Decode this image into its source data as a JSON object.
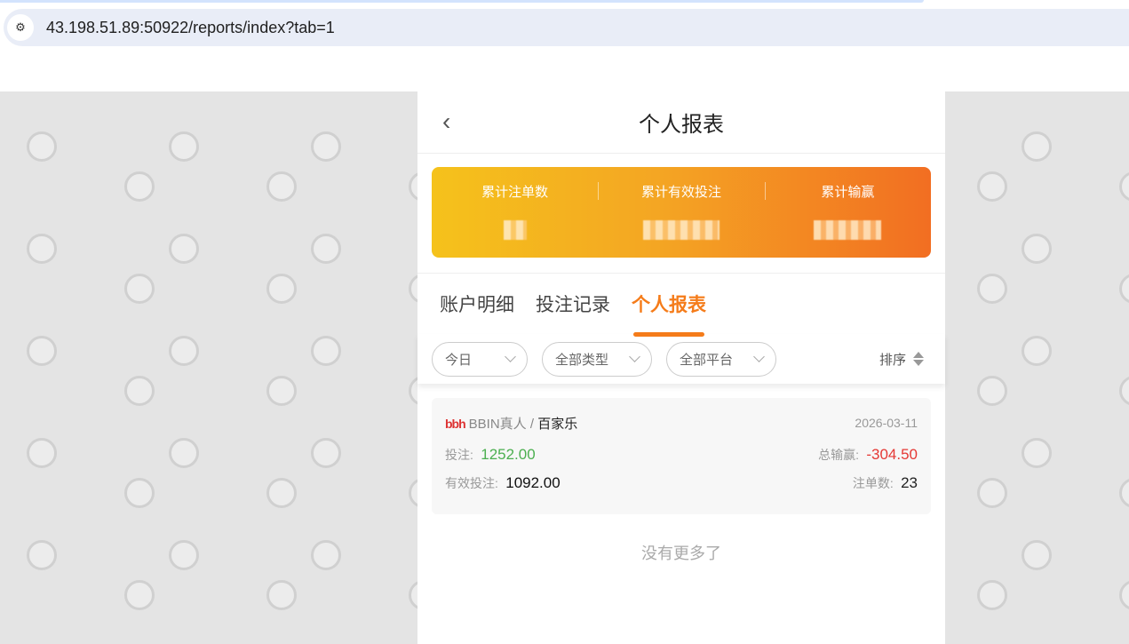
{
  "browser": {
    "url": "43.198.51.89:50922/reports/index?tab=1",
    "site_icon": "tune-icon"
  },
  "header": {
    "title": "个人报表"
  },
  "summary": [
    {
      "label": "累计注单数"
    },
    {
      "label": "累计有效投注"
    },
    {
      "label": "累计输赢"
    }
  ],
  "tabs": [
    {
      "label": "账户明细"
    },
    {
      "label": "投注记录"
    },
    {
      "label": "个人报表",
      "active": true
    }
  ],
  "filters": {
    "date": "今日",
    "type": "全部类型",
    "platform": "全部平台",
    "sort": "排序"
  },
  "records": [
    {
      "logo": "bbin",
      "platform": "BBIN真人",
      "sep": "/",
      "game": "百家乐",
      "date": "2026-03-11",
      "bet_label": "投注:",
      "bet": "1252.00",
      "winloss_label": "总输赢:",
      "winloss": "-304.50",
      "valid_label": "有效投注:",
      "valid": "1092.00",
      "count_label": "注单数:",
      "count": "23"
    }
  ],
  "footer": "没有更多了",
  "colors": {
    "accent": "#f57c1a",
    "positive": "#4caf50",
    "negative": "#e53935"
  }
}
